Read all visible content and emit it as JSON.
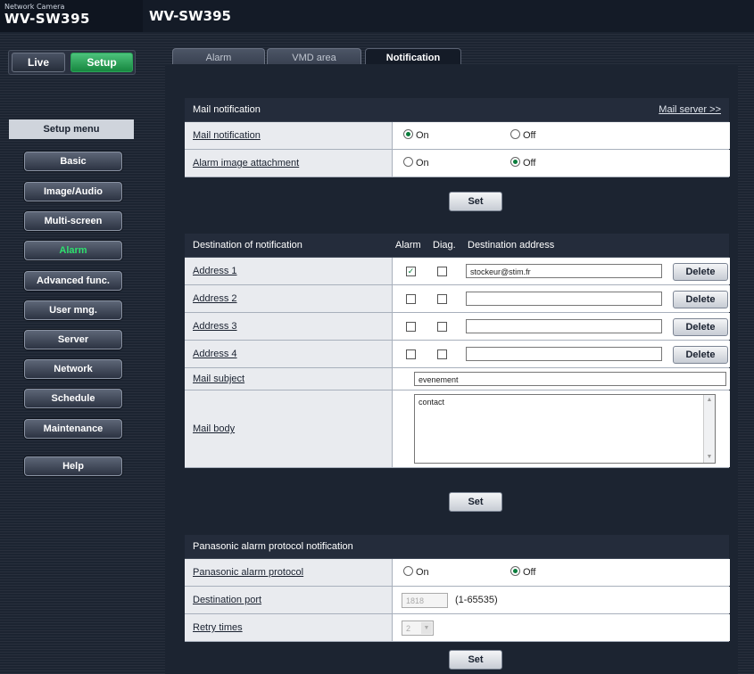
{
  "header": {
    "brand_small": "Network Camera",
    "brand_model": "WV-SW395",
    "model_title": "WV-SW395"
  },
  "sidebar": {
    "live_label": "Live",
    "setup_label": "Setup",
    "menu_title": "Setup menu",
    "items": [
      "Basic",
      "Image/Audio",
      "Multi-screen",
      "Alarm",
      "Advanced func.",
      "User mng.",
      "Server",
      "Network",
      "Schedule",
      "Maintenance"
    ],
    "help_label": "Help",
    "active_item": "Alarm",
    "active_color": "#2ee06e"
  },
  "tabs": [
    "Alarm",
    "VMD area",
    "Notification"
  ],
  "mail_notification": {
    "title": "Mail notification",
    "server_link": "Mail server >>",
    "rows": [
      {
        "label": "Mail notification",
        "on": "On",
        "off": "Off",
        "selected": "On"
      },
      {
        "label": "Alarm image attachment",
        "on": "On",
        "off": "Off",
        "selected": "Off"
      }
    ],
    "set_label": "Set"
  },
  "destination": {
    "title": "Destination of notification",
    "col_alarm": "Alarm",
    "col_diag": "Diag.",
    "col_address": "Destination address",
    "addresses": [
      {
        "label": "Address 1",
        "alarm": true,
        "diag": false,
        "value": "stockeur@stim.fr",
        "delete": "Delete"
      },
      {
        "label": "Address 2",
        "alarm": false,
        "diag": false,
        "value": "",
        "delete": "Delete"
      },
      {
        "label": "Address 3",
        "alarm": false,
        "diag": false,
        "value": "",
        "delete": "Delete"
      },
      {
        "label": "Address 4",
        "alarm": false,
        "diag": false,
        "value": "",
        "delete": "Delete"
      }
    ],
    "subject_label": "Mail subject",
    "subject_value": "evenement",
    "body_label": "Mail body",
    "body_value": "contact",
    "set_label": "Set"
  },
  "panasonic": {
    "title": "Panasonic alarm protocol notification",
    "protocol_label": "Panasonic alarm protocol",
    "on": "On",
    "off": "Off",
    "selected": "Off",
    "port_label": "Destination port",
    "port_value": "1818",
    "port_range": "(1-65535)",
    "retry_label": "Retry times",
    "retry_value": "2",
    "set_label": "Set"
  }
}
